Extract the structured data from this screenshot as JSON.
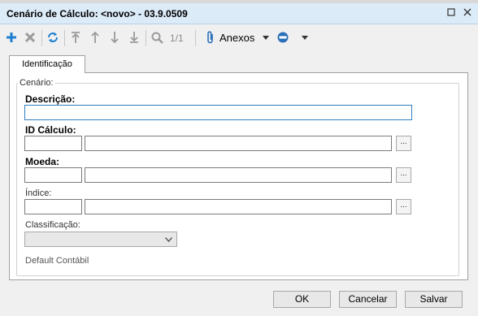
{
  "window": {
    "title": "Cenário de Cálculo: <novo> - 03.9.0509"
  },
  "toolbar": {
    "pager": "1/1",
    "anexos_label": "Anexos"
  },
  "tabs": [
    {
      "label": "Identificação"
    }
  ],
  "group": {
    "label": "Cenário:"
  },
  "form": {
    "descricao_label": "Descrição:",
    "descricao_value": "",
    "id_calculo_label": "ID Cálculo:",
    "id_calculo_code": "",
    "id_calculo_desc": "",
    "moeda_label": "Moeda:",
    "moeda_code": "",
    "moeda_desc": "",
    "indice_label": "Índice:",
    "indice_code": "",
    "indice_desc": "",
    "lookup_label": "...",
    "classificacao_label": "Classificação:",
    "classificacao_value": "",
    "default_contabil_label": "Default Contábil"
  },
  "footer": {
    "ok_label": "OK",
    "cancel_label": "Cancelar",
    "save_label": "Salvar"
  },
  "colors": {
    "accent": "#1e7fd0",
    "titlebar": "#dcebf8",
    "disabled_icon": "#9a9a9a"
  }
}
